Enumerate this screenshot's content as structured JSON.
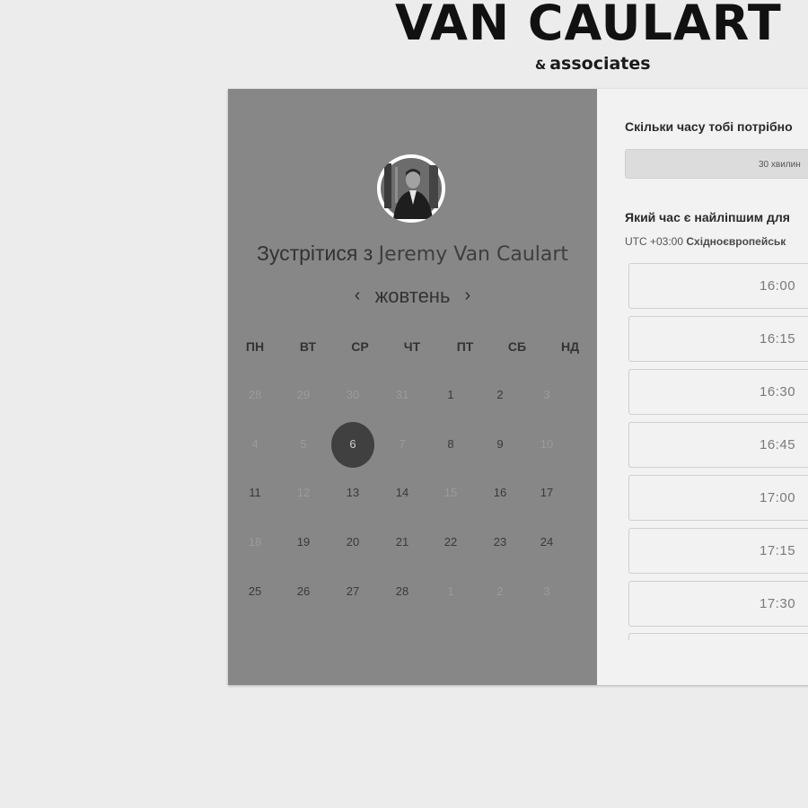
{
  "brand": {
    "title": "VAN CAULART",
    "amp": "&",
    "subtitle": "associates"
  },
  "calendar": {
    "meet_prefix": "Зустрітися з",
    "meet_name": "Jeremy Van Caulart",
    "month": "жовтень",
    "prev_arrow": "‹",
    "next_arrow": "›",
    "weekdays": [
      "ПН",
      "ВТ",
      "СР",
      "ЧТ",
      "ПТ",
      "СБ",
      "НД"
    ],
    "weeks": [
      [
        {
          "d": "28",
          "m": true
        },
        {
          "d": "29",
          "m": true
        },
        {
          "d": "30",
          "m": true
        },
        {
          "d": "31",
          "m": true
        },
        {
          "d": "1"
        },
        {
          "d": "2"
        },
        {
          "d": "3",
          "m": true
        }
      ],
      [
        {
          "d": "4",
          "m": true
        },
        {
          "d": "5",
          "m": true
        },
        {
          "d": "6",
          "sel": true
        },
        {
          "d": "7",
          "m": true
        },
        {
          "d": "8"
        },
        {
          "d": "9"
        },
        {
          "d": "10",
          "m": true
        }
      ],
      [
        {
          "d": "11"
        },
        {
          "d": "12",
          "m": true
        },
        {
          "d": "13"
        },
        {
          "d": "14"
        },
        {
          "d": "15",
          "m": true
        },
        {
          "d": "16"
        },
        {
          "d": "17"
        }
      ],
      [
        {
          "d": "18",
          "m": true
        },
        {
          "d": "19"
        },
        {
          "d": "20"
        },
        {
          "d": "21"
        },
        {
          "d": "22"
        },
        {
          "d": "23"
        },
        {
          "d": "24"
        }
      ],
      [
        {
          "d": "25"
        },
        {
          "d": "26"
        },
        {
          "d": "27"
        },
        {
          "d": "28"
        },
        {
          "d": "1",
          "m": true
        },
        {
          "d": "2",
          "m": true
        },
        {
          "d": "3",
          "m": true
        }
      ]
    ]
  },
  "booking": {
    "duration_question": "Скільки часу тобі потрібно",
    "duration_value": "30 хвилин",
    "time_question": "Який час є найліпшим для",
    "tz_offset": "UTC +03:00",
    "tz_name": "Східноєвропейськ",
    "slots": [
      "16:00",
      "16:15",
      "16:30",
      "16:45",
      "17:00",
      "17:15",
      "17:30"
    ]
  },
  "colors": {
    "left_panel": "#878787",
    "right_panel": "#f2f2f2",
    "selected_day": "#404040",
    "background": "#ececec"
  }
}
